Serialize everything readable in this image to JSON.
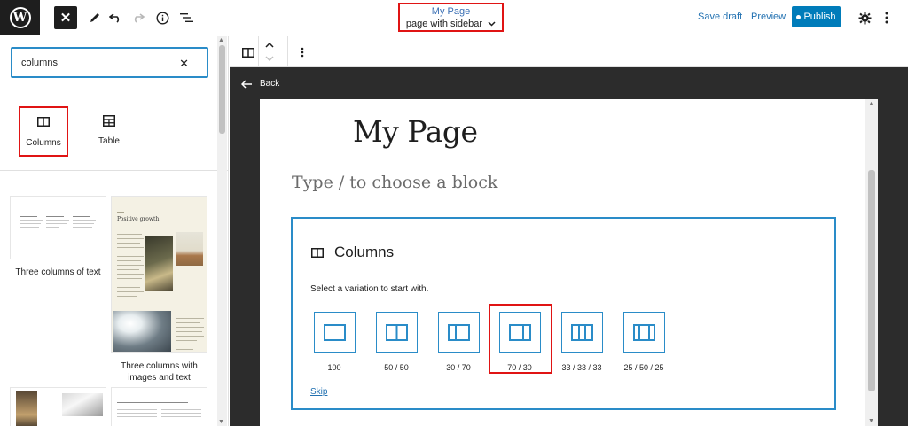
{
  "topbar": {
    "logo": "W",
    "close_icon": "✕",
    "doc_title": "My Page",
    "template_name": "page with sidebar",
    "save_draft": "Save draft",
    "preview": "Preview",
    "publish": "Publish"
  },
  "inserter": {
    "search_value": "columns",
    "blocks": [
      {
        "label": "Columns",
        "icon": "columns-icon"
      },
      {
        "label": "Table",
        "icon": "table-icon"
      }
    ],
    "patterns": [
      {
        "label": "Three columns of text"
      },
      {
        "label": "Three columns with images and text",
        "heading": "Positive growth."
      }
    ]
  },
  "canvas": {
    "back": "Back",
    "page_title": "My Page",
    "placeholder": "Type / to choose a block",
    "columns_block": {
      "title": "Columns",
      "instruction": "Select a variation to start with.",
      "variations": [
        {
          "label": "100",
          "icon": "columns-100-icon"
        },
        {
          "label": "50 / 50",
          "icon": "columns-50-50-icon"
        },
        {
          "label": "30 / 70",
          "icon": "columns-30-70-icon"
        },
        {
          "label": "70 / 30",
          "icon": "columns-70-30-icon"
        },
        {
          "label": "33 / 33 / 33",
          "icon": "columns-33-33-33-icon"
        },
        {
          "label": "25 / 50 / 25",
          "icon": "columns-25-50-25-icon"
        }
      ],
      "skip": "Skip"
    }
  },
  "colors": {
    "accent": "#007cba",
    "link": "#2271b1",
    "highlight": "#e01414",
    "canvas_bg": "#2c2c2c"
  }
}
